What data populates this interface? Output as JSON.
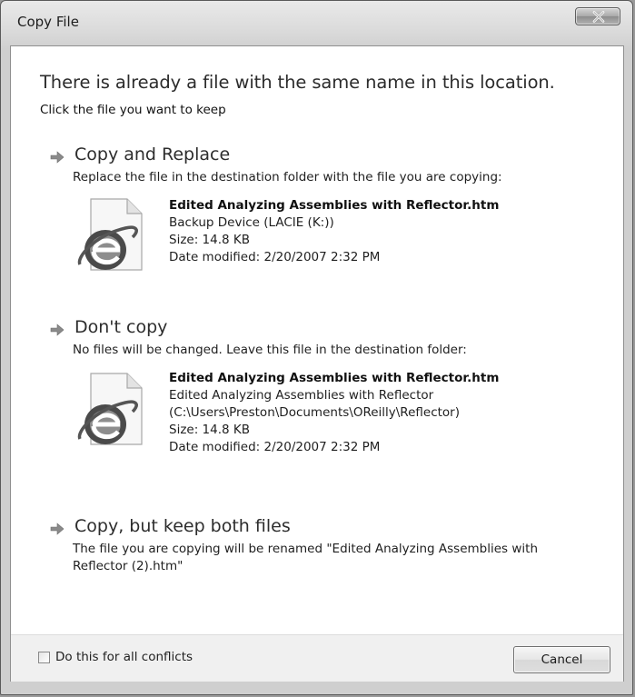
{
  "window": {
    "title": "Copy File"
  },
  "main": {
    "heading": "There is already a file with the same name in this location.",
    "subheading": "Click the file you want to keep"
  },
  "options": [
    {
      "title": "Copy and Replace",
      "description": "Replace the file in the destination folder with the file you are copying:",
      "file": {
        "name": "Edited Analyzing Assemblies with Reflector.htm",
        "location_lines": [
          "Backup Device (LACIE (K:))"
        ],
        "size": "Size: 14.8 KB",
        "modified": "Date modified: 2/20/2007 2:32 PM",
        "icon": "internet-explorer-document-icon"
      }
    },
    {
      "title": "Don't copy",
      "description": "No files will be changed. Leave this file in the destination folder:",
      "file": {
        "name": "Edited Analyzing Assemblies with Reflector.htm",
        "location_lines": [
          "Edited Analyzing Assemblies with Reflector",
          "(C:\\Users\\Preston\\Documents\\OReilly\\Reflector)"
        ],
        "size": "Size: 14.8 KB",
        "modified": "Date modified: 2/20/2007 2:32 PM",
        "icon": "internet-explorer-document-icon"
      }
    },
    {
      "title": "Copy, but keep both files",
      "description": "The file you are copying will be renamed \"Edited Analyzing Assemblies with Reflector (2).htm\""
    }
  ],
  "footer": {
    "checkbox_label": "Do this for all conflicts",
    "checkbox_checked": false,
    "cancel_label": "Cancel"
  },
  "icons": {
    "close": "close-icon",
    "option_arrow": "arrow-right-icon"
  },
  "colors": {
    "titlebar": "#dcdcdc",
    "content_bg": "#ffffff",
    "footer_bg": "#f0f0f0",
    "arrow": "#7a7a7a"
  }
}
